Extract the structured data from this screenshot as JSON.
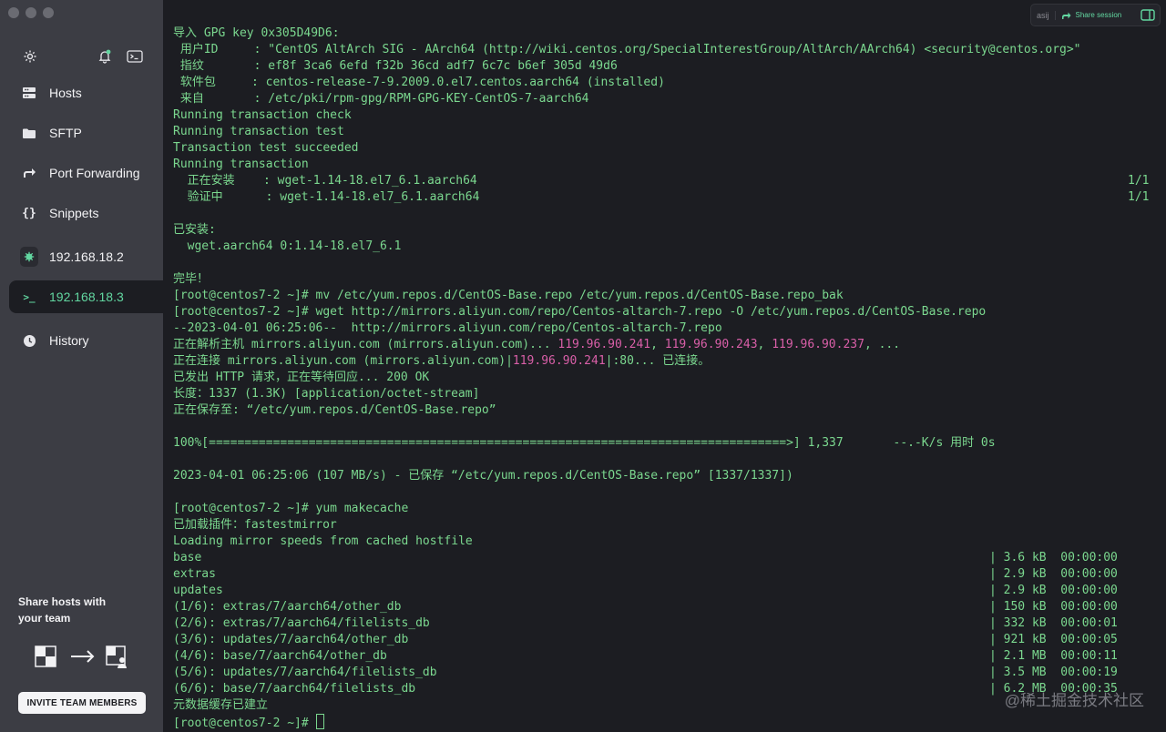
{
  "sidebar": {
    "items": [
      {
        "label": "Hosts",
        "icon": "hosts-icon"
      },
      {
        "label": "SFTP",
        "icon": "folder-icon"
      },
      {
        "label": "Port Forwarding",
        "icon": "port-forwarding-icon"
      },
      {
        "label": "Snippets",
        "icon": "snippets-icon"
      },
      {
        "label": "192.168.18.2",
        "icon": "host-icon"
      },
      {
        "label": "192.168.18.3",
        "icon": "terminal-icon",
        "active": true
      },
      {
        "label": "History",
        "icon": "history-icon"
      }
    ],
    "share_text": "Share hosts with your team",
    "invite_label": "INVITE TEAM MEMBERS"
  },
  "topbar": {
    "user": "asij",
    "share_label": "Share session"
  },
  "terminal": {
    "lines": [
      "导入 GPG key 0x305D49D6:",
      " 用户ID     : \"CentOS AltArch SIG - AArch64 (http://wiki.centos.org/SpecialInterestGroup/AltArch/AArch64) <security@centos.org>\"",
      " 指纹       : ef8f 3ca6 6efd f32b 36cd adf7 6c7c b6ef 305d 49d6",
      " 软件包     : centos-release-7-9.2009.0.el7.centos.aarch64 (installed)",
      " 来自       : /etc/pki/rpm-gpg/RPM-GPG-KEY-CentOS-7-aarch64",
      "Running transaction check",
      "Running transaction test",
      "Transaction test succeeded",
      "Running transaction",
      "  正在安装    : wget-1.14-18.el7_6.1.aarch64",
      "  验证中      : wget-1.14-18.el7_6.1.aarch64",
      "",
      "已安装:",
      "  wget.aarch64 0:1.14-18.el7_6.1",
      "",
      "完毕！",
      "[root@centos7-2 ~]# mv /etc/yum.repos.d/CentOS-Base.repo /etc/yum.repos.d/CentOS-Base.repo_bak",
      "[root@centos7-2 ~]# wget http://mirrors.aliyun.com/repo/Centos-altarch-7.repo -O /etc/yum.repos.d/CentOS-Base.repo",
      "--2023-04-01 06:25:06--  http://mirrors.aliyun.com/repo/Centos-altarch-7.repo",
      "正在解析主机 mirrors.aliyun.com (mirrors.aliyun.com)... ",
      "正在连接 mirrors.aliyun.com (mirrors.aliyun.com)|",
      "已发出 HTTP 请求，正在等待回应... 200 OK",
      "长度：1337 (1.3K) [application/octet-stream]",
      "正在保存至: “/etc/yum.repos.d/CentOS-Base.repo”",
      "",
      "100%[=================================================================================>] 1,337       --.-K/s 用时 0s",
      "",
      "2023-04-01 06:25:06 (107 MB/s) - 已保存 “/etc/yum.repos.d/CentOS-Base.repo” [1337/1337])",
      "",
      "[root@centos7-2 ~]# yum makecache",
      "已加载插件：fastestmirror",
      "Loading mirror speeds from cached hostfile",
      "base",
      "extras",
      "updates",
      "(1/6): extras/7/aarch64/other_db",
      "(2/6): extras/7/aarch64/filelists_db",
      "(3/6): updates/7/aarch64/other_db",
      "(4/6): base/7/aarch64/other_db",
      "(5/6): updates/7/aarch64/filelists_db",
      "(6/6): base/7/aarch64/filelists_db",
      "元数据缓存已建立",
      "[root@centos7-2 ~]# "
    ],
    "right_col": {
      "9": "1/1",
      "10": "1/1",
      "32": "| 3.6 kB  00:00:00",
      "33": "| 2.9 kB  00:00:00",
      "34": "| 2.9 kB  00:00:00",
      "35": "| 150 kB  00:00:00",
      "36": "| 332 kB  00:00:01",
      "37": "| 921 kB  00:00:05",
      "38": "| 2.1 MB  00:00:11",
      "39": "| 3.5 MB  00:00:19",
      "40": "| 6.2 MB  00:00:35"
    },
    "resolve_ips": [
      "119.96.90.241",
      "119.96.90.243",
      "119.96.90.237"
    ],
    "resolve_tail": ", ...",
    "connect_ip": "119.96.90.241",
    "connect_tail": "|:80... 已连接。"
  },
  "watermark": "@稀土掘金技术社区",
  "colors": {
    "accent": "#62d6a0",
    "terminal_text": "#7bd88f",
    "ip": "#d95fa8",
    "sidebar_bg": "#3c3d44",
    "terminal_bg": "#1c1d22"
  }
}
